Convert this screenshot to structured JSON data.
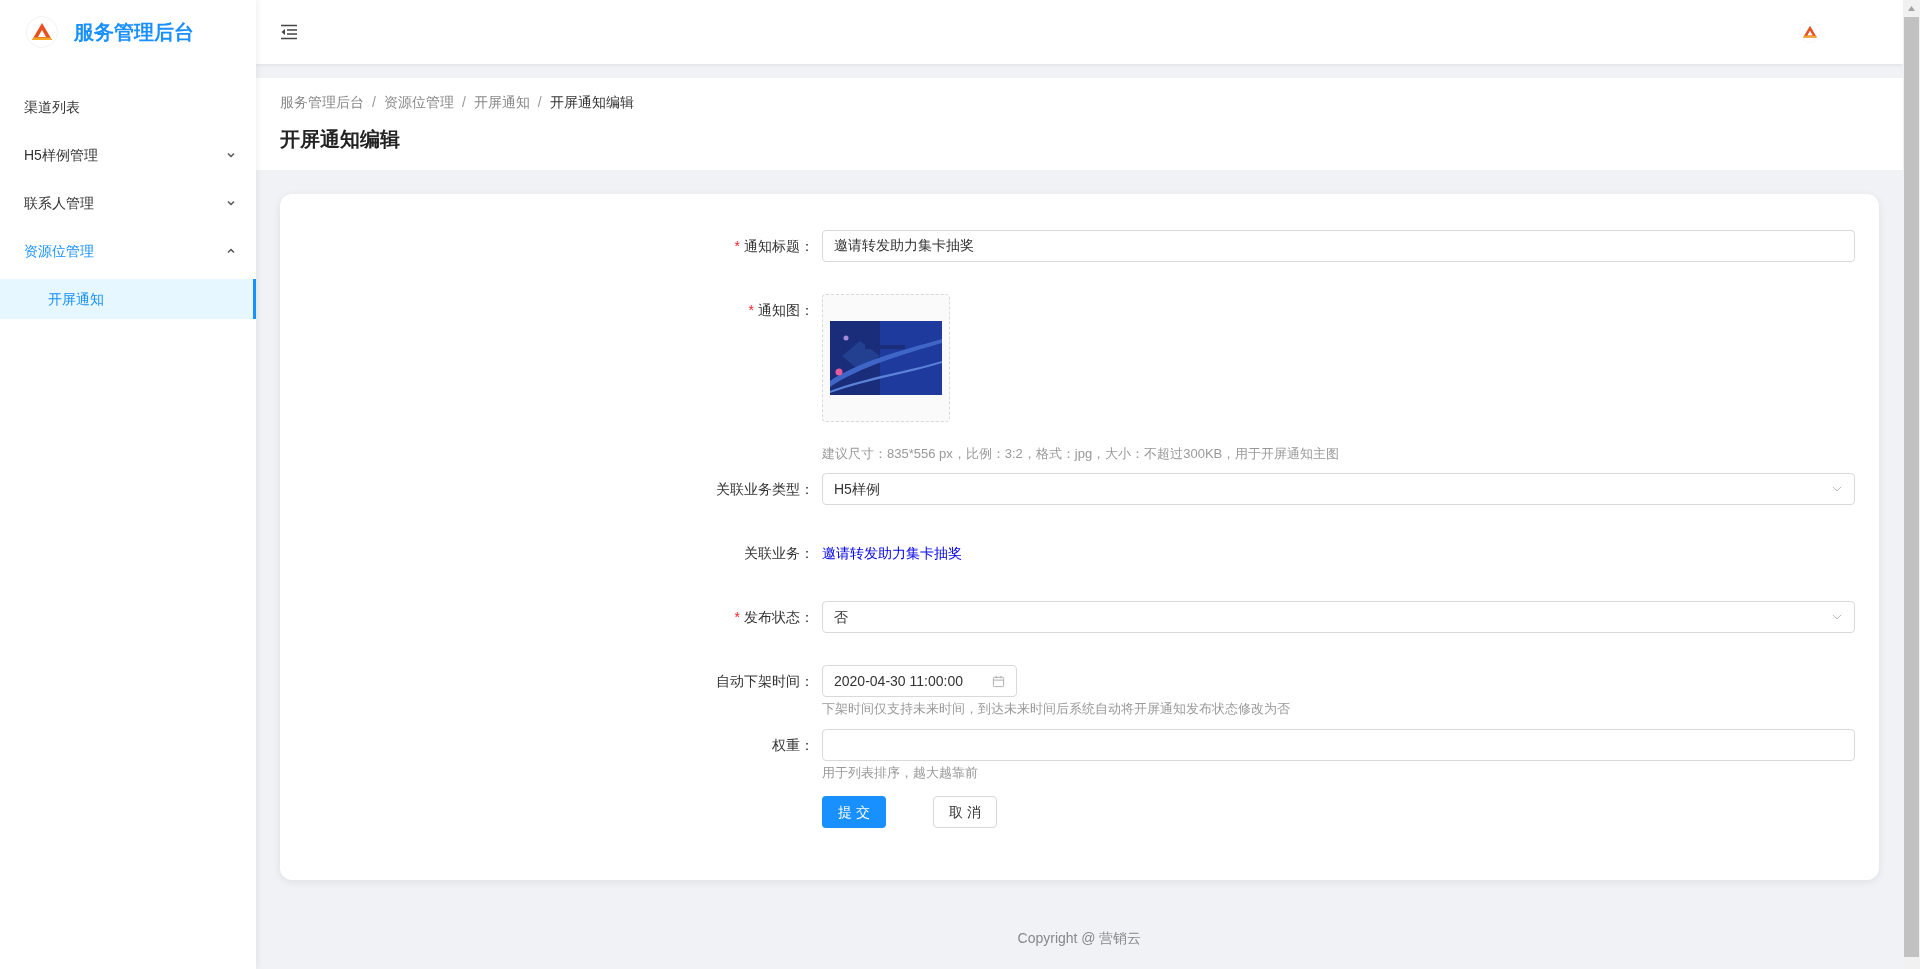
{
  "sidebar": {
    "title": "服务管理后台",
    "items": [
      {
        "label": "渠道列表",
        "selected": false
      },
      {
        "label": "H5样例管理",
        "selected": false,
        "expanded": false
      },
      {
        "label": "联系人管理",
        "selected": false,
        "expanded": false
      },
      {
        "label": "资源位管理",
        "selected": true,
        "expanded": true,
        "children": [
          {
            "label": "开屏通知",
            "selected": true
          }
        ]
      }
    ]
  },
  "breadcrumb": [
    {
      "kind": "link",
      "text": "服务管理后台"
    },
    {
      "kind": "separator",
      "text": "/"
    },
    {
      "kind": "link",
      "text": "资源位管理"
    },
    {
      "kind": "separator",
      "text": "/"
    },
    {
      "kind": "link",
      "text": "开屏通知"
    },
    {
      "kind": "separator",
      "text": "/"
    },
    {
      "kind": "current",
      "text": "开屏通知编辑"
    }
  ],
  "page_title": "开屏通知编辑",
  "form": {
    "fields": [
      {
        "kind": "text",
        "required_mark": "*",
        "label": "通知标题：",
        "value": "邀请转发助力集卡抽奖"
      },
      {
        "kind": "upload",
        "required_mark": "*",
        "label": "通知图：",
        "hint": "建议尺寸：835*556 px，比例：3:2，格式：jpg，大小：不超过300KB，用于开屏通知主图"
      },
      {
        "kind": "select",
        "label": "关联业务类型：",
        "value": "H5样例"
      },
      {
        "kind": "link",
        "label": "关联业务：",
        "value": "邀请转发助力集卡抽奖"
      },
      {
        "kind": "select",
        "required_mark": "*",
        "label": "发布状态：",
        "value": "否"
      },
      {
        "kind": "date",
        "label": "自动下架时间：",
        "value": "2020-04-30 11:00:00",
        "hint": "下架时间仅支持未来时间，到达未来时间后系统自动将开屏通知发布状态修改为否"
      },
      {
        "kind": "text",
        "label": "权重：",
        "hint": "用于列表排序，越大越靠前"
      }
    ],
    "buttons": [
      {
        "label": "提 交",
        "primary": true
      },
      {
        "label": "取 消",
        "primary": false
      }
    ]
  },
  "footer": "Copyright @ 营销云"
}
